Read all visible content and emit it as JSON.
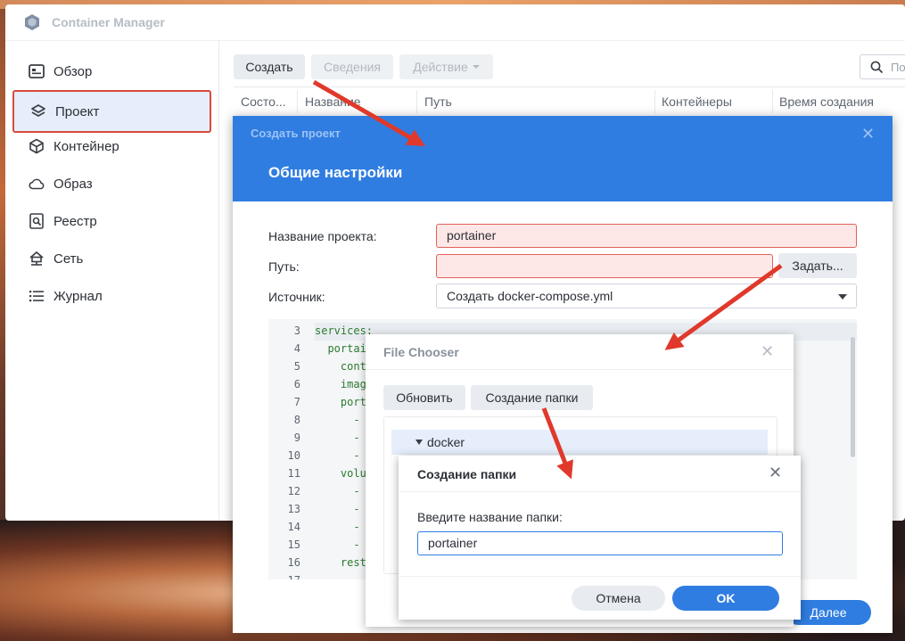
{
  "app": {
    "title": "Container Manager"
  },
  "sidebar": {
    "items": [
      {
        "label": "Обзор",
        "icon": "overview-icon"
      },
      {
        "label": "Проект",
        "icon": "layers-icon"
      },
      {
        "label": "Контейнер",
        "icon": "cube-icon"
      },
      {
        "label": "Образ",
        "icon": "cloud-icon"
      },
      {
        "label": "Реестр",
        "icon": "registry-search-icon"
      },
      {
        "label": "Сеть",
        "icon": "network-icon"
      },
      {
        "label": "Журнал",
        "icon": "list-icon"
      }
    ],
    "active_index": 1
  },
  "toolbar": {
    "create_label": "Создать",
    "details_label": "Сведения",
    "action_label": "Действие",
    "search_placeholder": "По"
  },
  "table": {
    "columns": [
      "Состо...",
      "Название",
      "Путь",
      "Контейнеры",
      "Время создания"
    ]
  },
  "create_dialog": {
    "small_title": "Создать проект",
    "title": "Общие настройки",
    "name_label": "Название проекта:",
    "name_value": "portainer",
    "path_label": "Путь:",
    "path_value": "",
    "set_button": "Задать...",
    "source_label": "Источник:",
    "source_value": "Создать docker-compose.yml",
    "next_button": "Далее",
    "editor_lines": [
      {
        "n": "3",
        "code": "services:"
      },
      {
        "n": "4",
        "code": "  portai"
      },
      {
        "n": "5",
        "code": "    cont"
      },
      {
        "n": "6",
        "code": "    imag"
      },
      {
        "n": "7",
        "code": "    port"
      },
      {
        "n": "8",
        "code": "      -"
      },
      {
        "n": "9",
        "code": "      -"
      },
      {
        "n": "10",
        "code": "      -"
      },
      {
        "n": "11",
        "code": "    volu"
      },
      {
        "n": "12",
        "code": "      -"
      },
      {
        "n": "13",
        "code": "      -"
      },
      {
        "n": "14",
        "code": "      -"
      },
      {
        "n": "15",
        "code": "      -"
      },
      {
        "n": "16",
        "code": "    rest"
      },
      {
        "n": "17",
        "code": ""
      }
    ]
  },
  "file_chooser": {
    "title": "File Chooser",
    "refresh_button": "Обновить",
    "new_folder_button": "Создание папки",
    "tree_root": "docker"
  },
  "new_folder_dialog": {
    "title": "Создание папки",
    "prompt": "Введите название папки:",
    "value": "portainer",
    "cancel_button": "Отмена",
    "ok_button": "OK"
  },
  "colors": {
    "accent": "#2f7de1",
    "highlight_border": "#d94a3c",
    "arrow": "#e0392b"
  }
}
